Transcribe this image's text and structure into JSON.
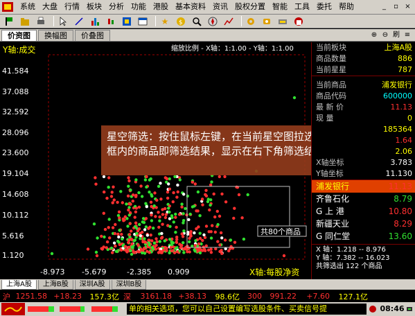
{
  "menubar": {
    "items": [
      "系统",
      "大盘",
      "行情",
      "板块",
      "分析",
      "功能",
      "港股",
      "基本资料",
      "资讯",
      "股权分置",
      "智能",
      "工具",
      "委托",
      "帮助"
    ]
  },
  "tabs": {
    "items": [
      "价资图",
      "换幅图",
      "价叠图"
    ],
    "active": 0
  },
  "chart": {
    "y_axis_title": "Y轴:成交",
    "scale_info": "缩放比例 - X轴：1:1.00 - Y轴：1:1.00",
    "x_axis_title": "X轴:每股净资",
    "yticks": [
      "41.584",
      "37.088",
      "32.592",
      "28.096",
      "23.600",
      "19.104",
      "14.608",
      "10.112",
      "5.616",
      "1.120"
    ],
    "xticks": [
      "-8.973",
      "-5.679",
      "-2.385",
      "0.909"
    ],
    "selection_label": "共80个商品"
  },
  "tooltip": {
    "text": "星空筛选：按住鼠标左键，在当前星空图拉选一个框，框内的商品即筛选结果，显示在右下角筛选结果列表中"
  },
  "right_panel": {
    "board": {
      "label": "当前板块",
      "value": "上海A股"
    },
    "count": {
      "label": "商品数量",
      "value": "886"
    },
    "stars": {
      "label": "当前星星",
      "value": "787"
    },
    "current_stock": {
      "label": "当前商品",
      "value": "浦发银行"
    },
    "code": {
      "label": "商品代码",
      "value": "600000"
    },
    "price": {
      "label": "最 新 价",
      "value": "11.13"
    },
    "volume": {
      "label": "现    量",
      "value": "0"
    },
    "v1": "185364",
    "v2": "1.64",
    "v3": "2.06",
    "xcoord": {
      "label": "X轴坐标",
      "value": "3.783"
    },
    "ycoord": {
      "label": "Y轴坐标",
      "value": "11.130"
    },
    "results": [
      {
        "name": "浦发银行",
        "value": "11.13"
      },
      {
        "name": "齐鲁石化",
        "value": "8.79"
      },
      {
        "name": "G 上  港",
        "value": "10.80"
      },
      {
        "name": "新疆天业",
        "value": "8.29"
      },
      {
        "name": "G 同仁堂",
        "value": "13.60"
      }
    ],
    "range_x": "X 轴：1.218 -- 8.976",
    "range_y": "Y 轴：7.382 -- 16.023",
    "filter_count": "共筛选出 122 个商品"
  },
  "bottom_tabs": [
    "上海A股",
    "上海B股",
    "深圳A股",
    "深圳B股"
  ],
  "status": {
    "sh_label": "沪",
    "sh_index": "1251.58",
    "sh_change": "+18.23",
    "sh_amount": "157.3亿",
    "sz_label": "深",
    "sz_index": "3161.18",
    "sz_change": "+38.13",
    "sz_amount": "98.6亿",
    "c_label": "300",
    "c_index": "991.22",
    "c_change": "+7.60",
    "c_amount": "127.1亿",
    "ticker": "单的相关选项，您可以自己设置编写选股条件、买卖信号提",
    "time": "08:46"
  },
  "colors": {
    "red": "#ff3030",
    "green": "#30e030",
    "yellow": "#ffff00",
    "cyan": "#00ffff",
    "grid_red": "#a00000"
  }
}
